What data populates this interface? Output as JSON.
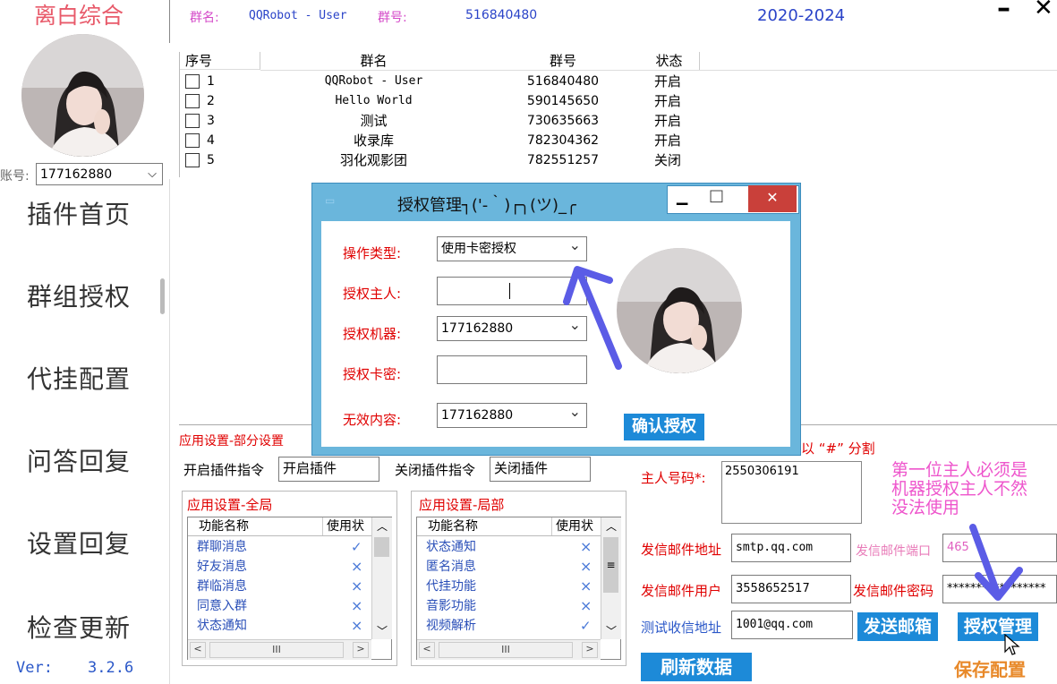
{
  "app": {
    "brand": "离白综合",
    "version_label": "Ver:",
    "version": "3.2.6",
    "year_range": "2020-2024"
  },
  "account": {
    "label": "账号:",
    "value": "177162880"
  },
  "nav": {
    "items": [
      {
        "label": "插件首页"
      },
      {
        "label": "群组授权"
      },
      {
        "label": "代挂配置"
      },
      {
        "label": "问答回复"
      },
      {
        "label": "设置回复"
      },
      {
        "label": "检查更新"
      }
    ]
  },
  "top": {
    "group_name_label": "群名:",
    "group_name": "QQRobot - User",
    "group_id_label": "群号:",
    "group_id": "516840480"
  },
  "window_controls": {
    "minimize": "–",
    "close": "✕"
  },
  "group_table": {
    "headers": [
      "序号",
      "群名",
      "群号",
      "状态"
    ],
    "rows": [
      {
        "idx": "1",
        "name": "QQRobot - User",
        "id": "516840480",
        "status": "开启"
      },
      {
        "idx": "2",
        "name": "Hello World",
        "id": "590145650",
        "status": "开启"
      },
      {
        "idx": "3",
        "name": "测试",
        "id": "730635663",
        "status": "开启"
      },
      {
        "idx": "4",
        "name": "收录库",
        "id": "782304362",
        "status": "开启"
      },
      {
        "idx": "5",
        "name": "羽化观影团",
        "id": "782551257",
        "status": "关闭"
      }
    ]
  },
  "dialog": {
    "title": "授权管理┐('-｀)┌╮(ツ)_╭",
    "min": "▁",
    "max": "□",
    "close": "✕",
    "op_type_label": "操作类型:",
    "op_type_value": "使用卡密授权",
    "owner_label": "授权主人:",
    "owner_value": "",
    "robot_label": "授权机器:",
    "robot_value": "177162880",
    "card_label": "授权卡密:",
    "card_value": "",
    "invalid_label": "无效内容:",
    "invalid_value": "177162880",
    "confirm_button": "确认授权"
  },
  "app_settings": {
    "partial_label": "应用设置-部分设置",
    "split_hint": "以 “#” 分割",
    "enable_cmd_label": "开启插件指令",
    "enable_cmd_value": "开启插件",
    "disable_cmd_label": "关闭插件指令",
    "disable_cmd_value": "关闭插件"
  },
  "global_list": {
    "title": "应用设置-全局",
    "col_name": "功能名称",
    "col_use": "使用状",
    "rows": [
      {
        "name": "群聊消息",
        "flag": "✓"
      },
      {
        "name": "好友消息",
        "flag": "×"
      },
      {
        "name": "群临消息",
        "flag": "×"
      },
      {
        "name": "同意入群",
        "flag": "×"
      },
      {
        "name": "状态通知",
        "flag": "×"
      }
    ],
    "hscroll_thumb": "III"
  },
  "local_list": {
    "title": "应用设置-局部",
    "col_name": "功能名称",
    "col_use": "使用状",
    "rows": [
      {
        "name": "状态通知",
        "flag": "×"
      },
      {
        "name": "匿名消息",
        "flag": "×"
      },
      {
        "name": "代挂功能",
        "flag": "×"
      },
      {
        "name": "音影功能",
        "flag": "×"
      },
      {
        "name": "视频解析",
        "flag": "✓"
      }
    ],
    "hscroll_thumb": "III"
  },
  "mail": {
    "owner_label": "主人号码*:",
    "owner_value": "2550306191",
    "note": "第一位主人必须是机器授权主人不然没法使用",
    "sender_addr_label": "发信邮件地址",
    "sender_addr_value": "smtp.qq.com",
    "sender_port_label": "发信邮件端口",
    "sender_port_value": "465",
    "sender_user_label": "发信邮件用户",
    "sender_user_value": "3558652517",
    "sender_pwd_label": "发信邮件密码",
    "sender_pwd_value": "*****************",
    "test_label": "测试收信地址",
    "test_value": "1001@qq.com",
    "send_button": "发送邮箱",
    "auth_button": "授权管理",
    "refresh_button": "刷新数据",
    "save_button": "保存配置"
  },
  "colors": {
    "accent_blue": "#1d8ad8",
    "brand_red": "#e85a6a",
    "label_red": "#e00000",
    "dialog_frame": "#6ab6dc",
    "annotation_arrow": "#5b5ce6",
    "note_pink": "#ee55cc"
  }
}
